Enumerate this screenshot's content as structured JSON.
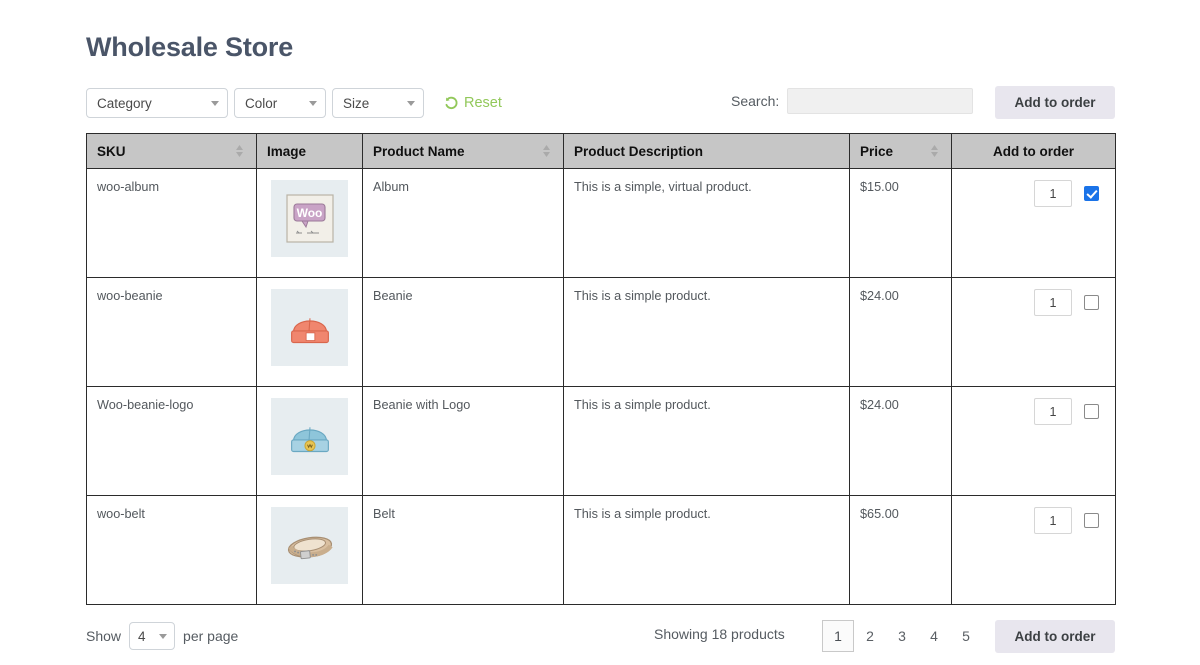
{
  "header": {
    "title": "Wholesale Store"
  },
  "toolbar": {
    "filters": [
      {
        "name": "category",
        "label": "Category"
      },
      {
        "name": "color",
        "label": "Color"
      },
      {
        "name": "size",
        "label": "Size"
      }
    ],
    "reset_label": "Reset",
    "reset_icon": "undo-arrow-icon",
    "search_label": "Search:",
    "search_value": "",
    "search_placeholder": "",
    "add_to_order_label": "Add to order"
  },
  "table": {
    "columns": [
      {
        "label": "SKU",
        "sortable": true,
        "align": "left"
      },
      {
        "label": "Image",
        "sortable": false,
        "align": "left"
      },
      {
        "label": "Product Name",
        "sortable": true,
        "align": "left"
      },
      {
        "label": "Product Description",
        "sortable": false,
        "align": "left"
      },
      {
        "label": "Price",
        "sortable": true,
        "align": "left"
      },
      {
        "label": "Add to order",
        "sortable": false,
        "align": "center"
      }
    ],
    "rows": [
      {
        "sku": "woo-album",
        "image": "album-thumbnail",
        "name": "Album",
        "description": "This is a simple, virtual product.",
        "price": "$15.00",
        "qty": "1",
        "checked": true
      },
      {
        "sku": "woo-beanie",
        "image": "beanie-thumbnail",
        "name": "Beanie",
        "description": "This is a simple product.",
        "price": "$24.00",
        "qty": "1",
        "checked": false
      },
      {
        "sku": "Woo-beanie-logo",
        "image": "beanie-with-logo-thumbnail",
        "name": "Beanie with Logo",
        "description": "This is a simple product.",
        "price": "$24.00",
        "qty": "1",
        "checked": false
      },
      {
        "sku": "woo-belt",
        "image": "belt-thumbnail",
        "name": "Belt",
        "description": "This is a simple product.",
        "price": "$65.00",
        "qty": "1",
        "checked": false
      }
    ]
  },
  "footer": {
    "show_label": "Show",
    "per_page_value": "4",
    "per_page_label": "per page",
    "showing_text": "Showing 18 products",
    "pages": [
      "1",
      "2",
      "3",
      "4",
      "5"
    ],
    "active_page": "1",
    "add_to_order_label": "Add to order"
  },
  "colors": {
    "title": "#4a5568",
    "accent_green": "#92c85a",
    "link_green": "#9dc96b",
    "header_bg": "#c6c6c6",
    "button_bg": "#e8e6ee",
    "checkbox_checked": "#1a73e8",
    "thumb_bg": "#e7edf0"
  }
}
